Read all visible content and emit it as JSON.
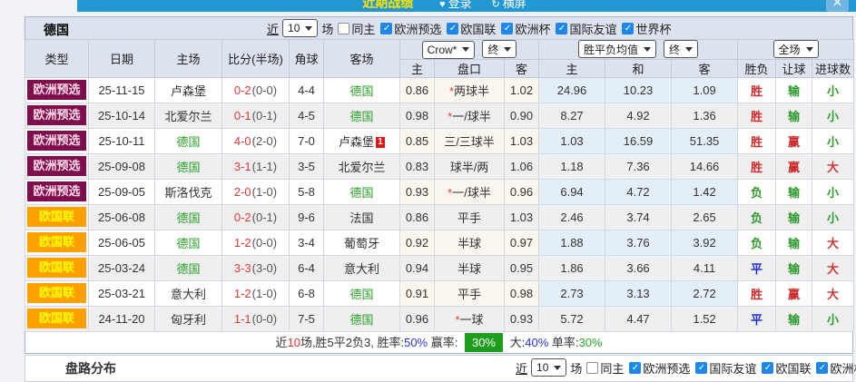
{
  "topbar": {
    "title": "近期战绩",
    "login_icon": "♥",
    "login": "登录",
    "rotate_icon": "↻",
    "landscape": "横屏",
    "close_icon": "✕"
  },
  "filter": {
    "team": "德国",
    "recent": "近",
    "count": "10",
    "matches": "场",
    "same_home": "同主",
    "competitions": [
      "欧洲预选",
      "欧国联",
      "欧洲杯",
      "国际友谊",
      "世界杯"
    ]
  },
  "table": {
    "headers": [
      "类型",
      "日期",
      "主场",
      "比分(半场)",
      "角球",
      "客场"
    ],
    "sub_headers": [
      "主",
      "盘口",
      "客",
      "主",
      "和",
      "客",
      "胜负",
      "让球",
      "进球数"
    ],
    "selects": {
      "odds_source": "Crow*",
      "odds_state": "终",
      "avg": "胜平负均值",
      "avg_state": "终",
      "scope": "全场"
    },
    "type_styles": {
      "欧洲预选": {
        "bg": "#7c0f4c",
        "fg": "#ffd8e8"
      },
      "欧国联": {
        "bg": "#ffa000",
        "fg": "#ffff00"
      }
    },
    "result_colors": {
      "胜": "#d02a2a",
      "负": "#2e9a2e",
      "平": "#2330cc",
      "输": "#2e9a2e",
      "赢": "#cc2a2a",
      "大": "#d03a3a",
      "小": "#2e9a2e"
    },
    "rows": [
      {
        "type": "欧洲预选",
        "date": "25-11-15",
        "home": "卢森堡",
        "home_highlight": false,
        "home_card": "",
        "score": "0-2",
        "half": "(0-0)",
        "corners": "4-4",
        "away": "德国",
        "away_highlight": true,
        "away_card": "",
        "odds_home": "0.86",
        "handicap_star": true,
        "handicap": "两球半",
        "odds_away": "1.02",
        "avg_home": "24.96",
        "avg_draw": "10.23",
        "avg_away": "1.09",
        "outcome": "胜",
        "handicap_outcome": "输",
        "goals_outcome": "小"
      },
      {
        "type": "欧洲预选",
        "date": "25-10-14",
        "home": "北爱尔兰",
        "home_highlight": false,
        "home_card": "",
        "score": "0-1",
        "half": "(0-1)",
        "corners": "4-5",
        "away": "德国",
        "away_highlight": true,
        "away_card": "",
        "odds_home": "0.98",
        "handicap_star": true,
        "handicap": "一/球半",
        "odds_away": "0.90",
        "avg_home": "8.27",
        "avg_draw": "4.92",
        "avg_away": "1.36",
        "outcome": "胜",
        "handicap_outcome": "输",
        "goals_outcome": "小"
      },
      {
        "type": "欧洲预选",
        "date": "25-10-11",
        "home": "德国",
        "home_highlight": true,
        "home_card": "",
        "score": "4-0",
        "half": "(2-0)",
        "corners": "7-0",
        "away": "卢森堡",
        "away_highlight": false,
        "away_card": "1",
        "odds_home": "0.85",
        "handicap_star": false,
        "handicap": "三/三球半",
        "odds_away": "1.03",
        "avg_home": "1.03",
        "avg_draw": "16.59",
        "avg_away": "51.35",
        "outcome": "胜",
        "handicap_outcome": "赢",
        "goals_outcome": "小"
      },
      {
        "type": "欧洲预选",
        "date": "25-09-08",
        "home": "德国",
        "home_highlight": true,
        "home_card": "",
        "score": "3-1",
        "half": "(1-1)",
        "corners": "3-5",
        "away": "北爱尔兰",
        "away_highlight": false,
        "away_card": "",
        "odds_home": "0.83",
        "handicap_star": false,
        "handicap": "球半/两",
        "odds_away": "1.06",
        "avg_home": "1.18",
        "avg_draw": "7.36",
        "avg_away": "14.66",
        "outcome": "胜",
        "handicap_outcome": "赢",
        "goals_outcome": "大"
      },
      {
        "type": "欧洲预选",
        "date": "25-09-05",
        "home": "斯洛伐克",
        "home_highlight": false,
        "home_card": "",
        "score": "2-0",
        "half": "(1-0)",
        "corners": "5-8",
        "away": "德国",
        "away_highlight": true,
        "away_card": "",
        "odds_home": "0.93",
        "handicap_star": true,
        "handicap": "一/球半",
        "odds_away": "0.96",
        "avg_home": "6.94",
        "avg_draw": "4.72",
        "avg_away": "1.42",
        "outcome": "负",
        "handicap_outcome": "输",
        "goals_outcome": "小"
      },
      {
        "type": "欧国联",
        "date": "25-06-08",
        "home": "德国",
        "home_highlight": true,
        "home_card": "",
        "score": "0-2",
        "half": "(0-1)",
        "corners": "9-6",
        "away": "法国",
        "away_highlight": false,
        "away_card": "",
        "odds_home": "0.86",
        "handicap_star": false,
        "handicap": "平手",
        "odds_away": "1.03",
        "avg_home": "2.46",
        "avg_draw": "3.74",
        "avg_away": "2.65",
        "outcome": "负",
        "handicap_outcome": "输",
        "goals_outcome": "小"
      },
      {
        "type": "欧国联",
        "date": "25-06-05",
        "home": "德国",
        "home_highlight": true,
        "home_card": "",
        "score": "1-2",
        "half": "(0-0)",
        "corners": "3-4",
        "away": "葡萄牙",
        "away_highlight": false,
        "away_card": "",
        "odds_home": "0.92",
        "handicap_star": false,
        "handicap": "半球",
        "odds_away": "0.97",
        "avg_home": "1.88",
        "avg_draw": "3.76",
        "avg_away": "3.92",
        "outcome": "负",
        "handicap_outcome": "输",
        "goals_outcome": "大"
      },
      {
        "type": "欧国联",
        "date": "25-03-24",
        "home": "德国",
        "home_highlight": true,
        "home_card": "",
        "score": "3-3",
        "half": "(3-0)",
        "corners": "6-4",
        "away": "意大利",
        "away_highlight": false,
        "away_card": "",
        "odds_home": "0.94",
        "handicap_star": false,
        "handicap": "半球",
        "odds_away": "0.95",
        "avg_home": "1.86",
        "avg_draw": "3.66",
        "avg_away": "4.11",
        "outcome": "平",
        "handicap_outcome": "输",
        "goals_outcome": "大"
      },
      {
        "type": "欧国联",
        "date": "25-03-21",
        "home": "意大利",
        "home_highlight": false,
        "home_card": "",
        "score": "1-2",
        "half": "(1-0)",
        "corners": "6-8",
        "away": "德国",
        "away_highlight": true,
        "away_card": "",
        "odds_home": "0.91",
        "handicap_star": false,
        "handicap": "平手",
        "odds_away": "0.98",
        "avg_home": "2.73",
        "avg_draw": "3.13",
        "avg_away": "2.72",
        "outcome": "胜",
        "handicap_outcome": "赢",
        "goals_outcome": "大"
      },
      {
        "type": "欧国联",
        "date": "24-11-20",
        "home": "匈牙利",
        "home_highlight": false,
        "home_card": "",
        "score": "1-1",
        "half": "(0-0)",
        "corners": "7-5",
        "away": "德国",
        "away_highlight": true,
        "away_card": "",
        "odds_home": "0.96",
        "handicap_star": true,
        "handicap": "一球",
        "odds_away": "0.93",
        "avg_home": "5.72",
        "avg_draw": "4.47",
        "avg_away": "1.52",
        "outcome": "平",
        "handicap_outcome": "输",
        "goals_outcome": "小"
      }
    ]
  },
  "summary": {
    "segments": [
      {
        "t": "近",
        "c": "text"
      },
      {
        "t": "10",
        "c": "red"
      },
      {
        "t": "场,胜5平2负3, ",
        "c": "text"
      },
      {
        "t": "胜率:",
        "c": "text"
      },
      {
        "t": "50%",
        "c": "blue"
      },
      {
        "t": " 赢率: ",
        "c": "text"
      },
      {
        "t": "30%",
        "c": "greenbox"
      },
      {
        "t": " 大:",
        "c": "text"
      },
      {
        "t": "40%",
        "c": "blue"
      },
      {
        "t": " 单率:",
        "c": "text"
      },
      {
        "t": "30%",
        "c": "green"
      }
    ]
  },
  "next_section": {
    "label": "盘路分布",
    "recent": "近",
    "count": "10",
    "matches": "场",
    "same_home": "同主",
    "competitions": [
      "欧洲预选",
      "国际友谊",
      "欧国联",
      "欧洲杯"
    ]
  }
}
